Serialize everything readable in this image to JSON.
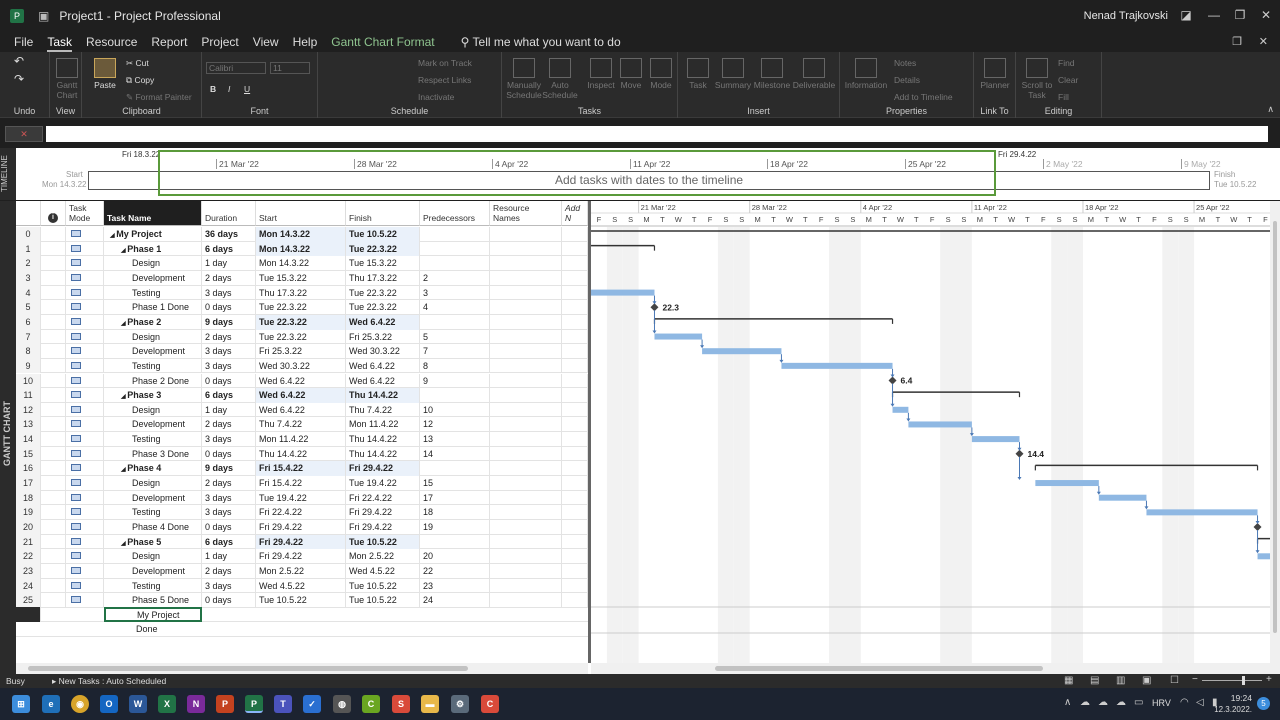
{
  "window": {
    "title": "Project1 - Project Professional",
    "user": "Nenad Trajkovski"
  },
  "menu": [
    "File",
    "Task",
    "Resource",
    "Report",
    "Project",
    "View",
    "Help"
  ],
  "menu_context": "Gantt Chart Format",
  "tell_me": "Tell me what you want to do",
  "ribbon": {
    "groups": [
      {
        "label": "Undo"
      },
      {
        "label": "View"
      },
      {
        "label": "Clipboard"
      },
      {
        "label": "Font"
      },
      {
        "label": "Schedule"
      },
      {
        "label": "Tasks"
      },
      {
        "label": "Insert"
      },
      {
        "label": "Properties"
      },
      {
        "label": "Link To"
      },
      {
        "label": "Editing"
      }
    ],
    "gantt_chart": "Gantt Chart",
    "paste": "Paste",
    "cut": "Cut",
    "copy": "Copy",
    "format_painter": "Format Painter",
    "font_name": "Calibri",
    "font_size": "11",
    "mark_on_track": "Mark on Track",
    "respect_links": "Respect Links",
    "inactivate": "Inactivate",
    "manually_schedule": "Manually Schedule",
    "auto_schedule": "Auto Schedule",
    "inspect": "Inspect",
    "move": "Move",
    "mode": "Mode",
    "task": "Task",
    "summary": "Summary",
    "milestone": "Milestone",
    "deliverable": "Deliverable",
    "information": "Information",
    "notes": "Notes",
    "details": "Details",
    "add_to_timeline": "Add to Timeline",
    "planner": "Planner",
    "scroll_to_task": "Scroll to Task",
    "find": "Find",
    "clear": "Clear",
    "fill": "Fill"
  },
  "timeline": {
    "label": "TIMELINE",
    "start_label": "Start",
    "start_date": "Mon 14.3.22",
    "finish_label": "Finish",
    "finish_date": "Tue 10.5.22",
    "left_date": "Fri 18.3.22",
    "right_date": "Fri 29.4.22",
    "ticks": [
      "21 Mar '22",
      "28 Mar '22",
      "4 Apr '22",
      "11 Apr '22",
      "18 Apr '22",
      "25 Apr '22",
      "2 May '22",
      "9 May '22"
    ],
    "placeholder": "Add tasks with dates to the timeline"
  },
  "view_label": "GANTT CHART",
  "columns": {
    "info": "i",
    "mode": "Task Mode",
    "name": "Task Name",
    "duration": "Duration",
    "start": "Start",
    "finish": "Finish",
    "predecessors": "Predecessors",
    "resources": "Resource Names",
    "add": "Add N"
  },
  "tasks": [
    {
      "id": "0",
      "name": "My Project",
      "duration": "36 days",
      "start": "Mon 14.3.22",
      "finish": "Tue 10.5.22",
      "pred": "",
      "level": 0,
      "summary": true
    },
    {
      "id": "1",
      "name": "Phase 1",
      "duration": "6 days",
      "start": "Mon 14.3.22",
      "finish": "Tue 22.3.22",
      "pred": "",
      "level": 1,
      "summary": true
    },
    {
      "id": "2",
      "name": "Design",
      "duration": "1 day",
      "start": "Mon 14.3.22",
      "finish": "Tue 15.3.22",
      "pred": "",
      "level": 2,
      "summary": false
    },
    {
      "id": "3",
      "name": "Development",
      "duration": "2 days",
      "start": "Tue 15.3.22",
      "finish": "Thu 17.3.22",
      "pred": "2",
      "level": 2,
      "summary": false
    },
    {
      "id": "4",
      "name": "Testing",
      "duration": "3 days",
      "start": "Thu 17.3.22",
      "finish": "Tue 22.3.22",
      "pred": "3",
      "level": 2,
      "summary": false
    },
    {
      "id": "5",
      "name": "Phase 1 Done",
      "duration": "0 days",
      "start": "Tue 22.3.22",
      "finish": "Tue 22.3.22",
      "pred": "4",
      "level": 2,
      "summary": false
    },
    {
      "id": "6",
      "name": "Phase 2",
      "duration": "9 days",
      "start": "Tue 22.3.22",
      "finish": "Wed 6.4.22",
      "pred": "",
      "level": 1,
      "summary": true
    },
    {
      "id": "7",
      "name": "Design",
      "duration": "2 days",
      "start": "Tue 22.3.22",
      "finish": "Fri 25.3.22",
      "pred": "5",
      "level": 2,
      "summary": false
    },
    {
      "id": "8",
      "name": "Development",
      "duration": "3 days",
      "start": "Fri 25.3.22",
      "finish": "Wed 30.3.22",
      "pred": "7",
      "level": 2,
      "summary": false
    },
    {
      "id": "9",
      "name": "Testing",
      "duration": "3 days",
      "start": "Wed 30.3.22",
      "finish": "Wed 6.4.22",
      "pred": "8",
      "level": 2,
      "summary": false
    },
    {
      "id": "10",
      "name": "Phase 2 Done",
      "duration": "0 days",
      "start": "Wed 6.4.22",
      "finish": "Wed 6.4.22",
      "pred": "9",
      "level": 2,
      "summary": false
    },
    {
      "id": "11",
      "name": "Phase 3",
      "duration": "6 days",
      "start": "Wed 6.4.22",
      "finish": "Thu 14.4.22",
      "pred": "",
      "level": 1,
      "summary": true
    },
    {
      "id": "12",
      "name": "Design",
      "duration": "1 day",
      "start": "Wed 6.4.22",
      "finish": "Thu 7.4.22",
      "pred": "10",
      "level": 2,
      "summary": false
    },
    {
      "id": "13",
      "name": "Development",
      "duration": "2 days",
      "start": "Thu 7.4.22",
      "finish": "Mon 11.4.22",
      "pred": "12",
      "level": 2,
      "summary": false
    },
    {
      "id": "14",
      "name": "Testing",
      "duration": "3 days",
      "start": "Mon 11.4.22",
      "finish": "Thu 14.4.22",
      "pred": "13",
      "level": 2,
      "summary": false
    },
    {
      "id": "15",
      "name": "Phase 3 Done",
      "duration": "0 days",
      "start": "Thu 14.4.22",
      "finish": "Thu 14.4.22",
      "pred": "14",
      "level": 2,
      "summary": false
    },
    {
      "id": "16",
      "name": "Phase 4",
      "duration": "9 days",
      "start": "Fri 15.4.22",
      "finish": "Fri 29.4.22",
      "pred": "",
      "level": 1,
      "summary": true
    },
    {
      "id": "17",
      "name": "Design",
      "duration": "2 days",
      "start": "Fri 15.4.22",
      "finish": "Tue 19.4.22",
      "pred": "15",
      "level": 2,
      "summary": false
    },
    {
      "id": "18",
      "name": "Development",
      "duration": "3 days",
      "start": "Tue 19.4.22",
      "finish": "Fri 22.4.22",
      "pred": "17",
      "level": 2,
      "summary": false
    },
    {
      "id": "19",
      "name": "Testing",
      "duration": "3 days",
      "start": "Fri 22.4.22",
      "finish": "Fri 29.4.22",
      "pred": "18",
      "level": 2,
      "summary": false
    },
    {
      "id": "20",
      "name": "Phase 4 Done",
      "duration": "0 days",
      "start": "Fri 29.4.22",
      "finish": "Fri 29.4.22",
      "pred": "19",
      "level": 2,
      "summary": false
    },
    {
      "id": "21",
      "name": "Phase 5",
      "duration": "6 days",
      "start": "Fri 29.4.22",
      "finish": "Tue 10.5.22",
      "pred": "",
      "level": 1,
      "summary": true
    },
    {
      "id": "22",
      "name": "Design",
      "duration": "1 day",
      "start": "Fri 29.4.22",
      "finish": "Mon 2.5.22",
      "pred": "20",
      "level": 2,
      "summary": false
    },
    {
      "id": "23",
      "name": "Development",
      "duration": "2 days",
      "start": "Mon 2.5.22",
      "finish": "Wed 4.5.22",
      "pred": "22",
      "level": 2,
      "summary": false
    },
    {
      "id": "24",
      "name": "Testing",
      "duration": "3 days",
      "start": "Wed 4.5.22",
      "finish": "Tue 10.5.22",
      "pred": "23",
      "level": 2,
      "summary": false
    },
    {
      "id": "25",
      "name": "Phase 5 Done",
      "duration": "0 days",
      "start": "Tue 10.5.22",
      "finish": "Tue 10.5.22",
      "pred": "24",
      "level": 2,
      "summary": false
    }
  ],
  "edit_cell": {
    "value": "My Project",
    "autocomplete": "Done"
  },
  "gantt": {
    "weeks": [
      "21 Mar '22",
      "28 Mar '22",
      "4 Apr '22",
      "11 Apr '22",
      "18 Apr '22",
      "25 Apr '22"
    ],
    "days": [
      "F",
      "S",
      "S",
      "M",
      "T",
      "W",
      "T",
      "F",
      "S",
      "S",
      "M",
      "T",
      "W",
      "T",
      "F",
      "S",
      "S",
      "M",
      "T",
      "W",
      "T",
      "F",
      "S",
      "S",
      "M",
      "T",
      "W",
      "T",
      "F",
      "S",
      "S",
      "M",
      "T",
      "W",
      "T",
      "F",
      "S",
      "S",
      "M",
      "T",
      "W",
      "T",
      "F",
      "S",
      "S",
      "M",
      "T",
      "W"
    ],
    "milestones": [
      {
        "row": 5,
        "label": "22.3"
      },
      {
        "row": 10,
        "label": "6.4"
      },
      {
        "row": 15,
        "label": "14.4"
      }
    ],
    "bar_color": "#8fb8e3",
    "summary_color": "#333333"
  },
  "status": {
    "left": "Busy",
    "mode": "New Tasks : Auto Scheduled"
  },
  "taskbar": {
    "lang": "HRV",
    "time": "19:24",
    "date": "12.3.2022.",
    "badge": "5"
  }
}
